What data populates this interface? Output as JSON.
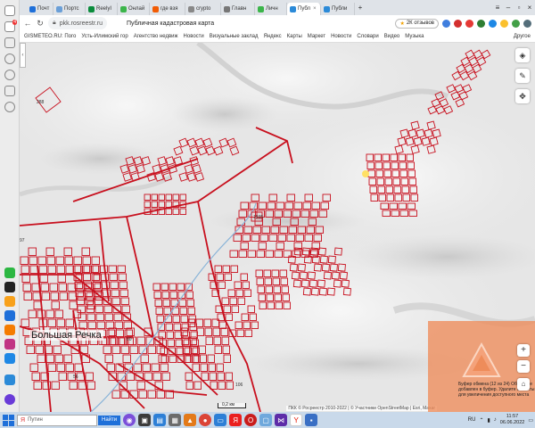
{
  "sidebar": {
    "badge": "4",
    "items": [
      "mail",
      "notes",
      "video",
      "zen",
      "downloads",
      "history",
      "whatsapp",
      "phone",
      "alice",
      "mail-2",
      "chat",
      "instagram",
      "music",
      "media",
      "profile"
    ]
  },
  "tabs": [
    {
      "label": "Почт",
      "color": "#1e6fd9"
    },
    {
      "label": "Портс",
      "color": "#6a9fd8"
    },
    {
      "label": "ReelyI",
      "color": "#0a8c3c"
    },
    {
      "label": "Онлай",
      "color": "#3bb54a"
    },
    {
      "label": "где взя",
      "color": "#f25c05"
    },
    {
      "label": "crypto",
      "color": "#888888"
    },
    {
      "label": "Главн",
      "color": "#777777"
    },
    {
      "label": "Личн",
      "color": "#3bb54a"
    },
    {
      "label": "Публ",
      "color": "#2b8ad8",
      "active": true
    },
    {
      "label": "Публи",
      "color": "#2b8ad8"
    }
  ],
  "address_bar": {
    "url": "pkk.rosreestr.ru",
    "page_title": "Публичная кадастровая карта",
    "reviews": "2К отзывов"
  },
  "bookmarks": [
    "GISMETEO.RU: Пого",
    "Усть-Илимский гор",
    "Агентство недвиж",
    "Новости",
    "Визуальные заклад",
    "Яндекс",
    "Карты",
    "Маркет",
    "Новости",
    "Словари",
    "Видео",
    "Музыка"
  ],
  "bookmarks_other": "Другое",
  "map": {
    "town": "Большая Речка",
    "parcel_labels": [
      "288",
      "97",
      "1935",
      "106",
      "60",
      "56"
    ],
    "scale": "0,2 км",
    "attribution": "ПКК © Росреестр 2010-2022 | © Участники OpenStreetMap | Esri, Maxar",
    "collapse": "‹",
    "zoom_in": "+",
    "zoom_out": "−"
  },
  "notification": {
    "text": "Буфер обмена (12 из 24) Объект не добавлен в буфер. Удалите объекты для увеличения доступного места"
  },
  "taskbar": {
    "search_placeholder": "Путин",
    "search_button": "Найти",
    "lang": "RU",
    "time": "11:57",
    "date": "06.06.2022"
  },
  "colors": {
    "parcel": "#c8101e",
    "accent": "#1e6fd9",
    "notification": "#ee8c5a"
  }
}
